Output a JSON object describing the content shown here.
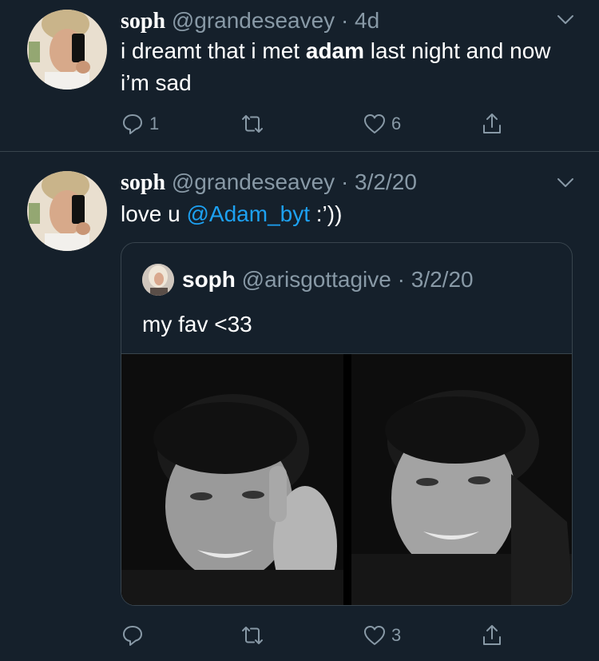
{
  "tweets": [
    {
      "name": "soph",
      "handle": "@grandeseavey",
      "separator": "·",
      "time": "4d",
      "text_before": "i dreamt that i met ",
      "text_bold": "adam",
      "text_after": " last night and now i’m sad",
      "replies": "1",
      "retweets": "",
      "likes": "6"
    },
    {
      "name": "soph",
      "handle": "@grandeseavey",
      "separator": "·",
      "time": "3/2/20",
      "text_before": "love u ",
      "mention": "@Adam_byt",
      "text_after": " :’))",
      "replies": "",
      "retweets": "",
      "likes": "3",
      "quote": {
        "name": "soph",
        "handle": "@arisgottagive",
        "separator": "·",
        "time": "3/2/20",
        "text": "my fav <33",
        "media_count": 2
      }
    }
  ],
  "icons": {
    "reply": "reply-icon",
    "retweet": "retweet-icon",
    "like": "heart-icon",
    "share": "share-icon",
    "more": "chevron-down-icon"
  },
  "colors": {
    "background": "#15202b",
    "secondary_text": "#8899a6",
    "link": "#1da1f2",
    "divider": "#38444d"
  }
}
